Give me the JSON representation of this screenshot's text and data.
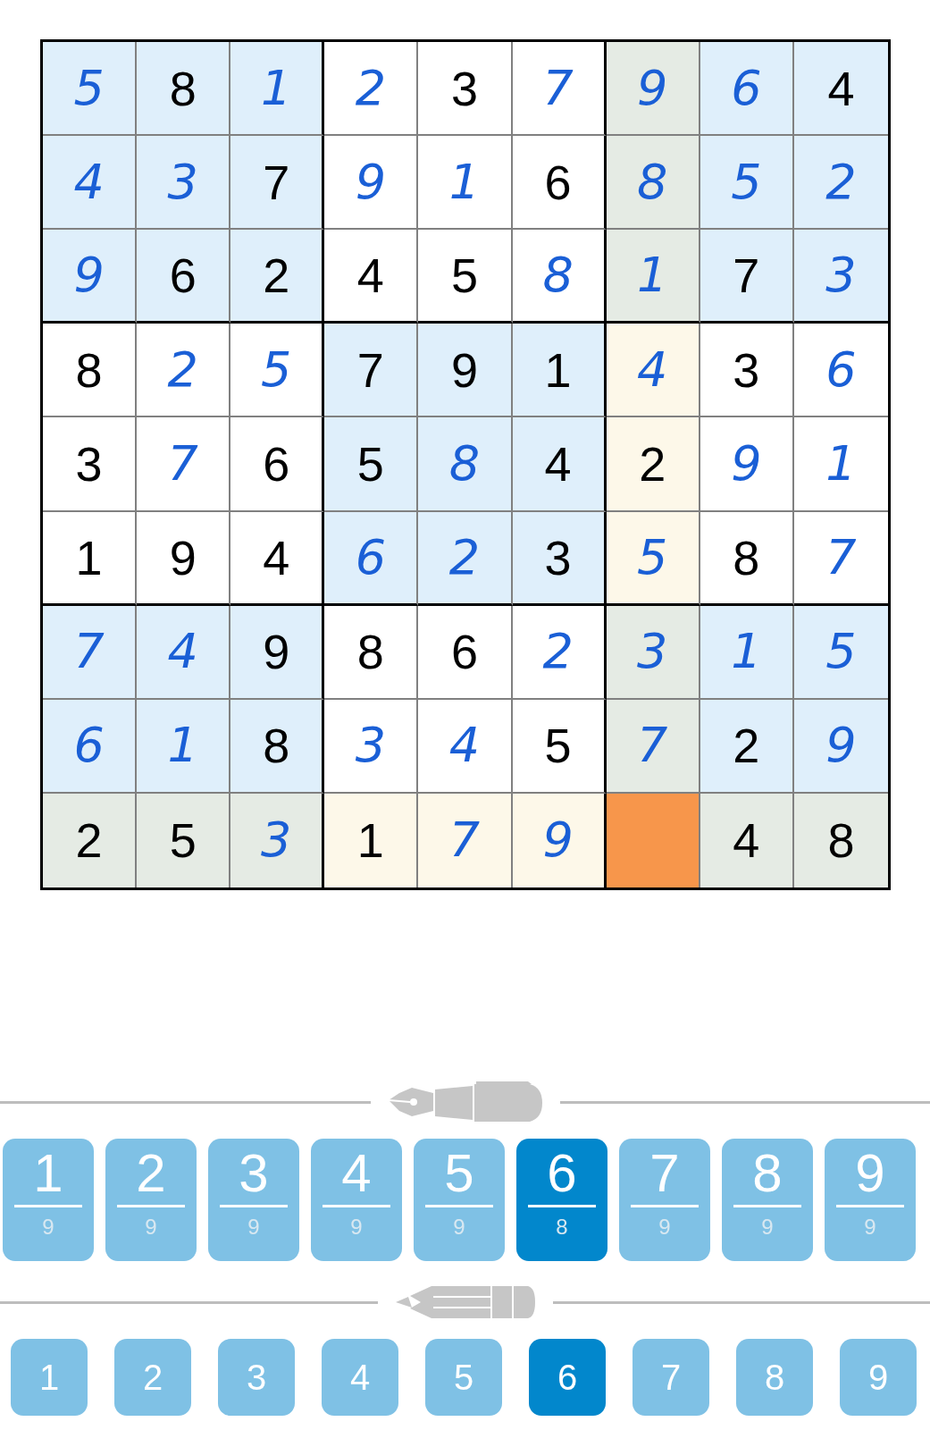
{
  "grid": [
    [
      {
        "value": "5",
        "kind": "entered",
        "color": "#dfeffb",
        "selected": false
      },
      {
        "value": "8",
        "kind": "given",
        "color": "#dfeffb",
        "selected": false
      },
      {
        "value": "1",
        "kind": "entered",
        "color": "#dfeffb",
        "selected": false
      },
      {
        "value": "2",
        "kind": "entered",
        "color": "#ffffff",
        "selected": false
      },
      {
        "value": "3",
        "kind": "given",
        "color": "#ffffff",
        "selected": false
      },
      {
        "value": "7",
        "kind": "entered",
        "color": "#ffffff",
        "selected": false
      },
      {
        "value": "9",
        "kind": "entered",
        "color": "#e5ebe4",
        "selected": false
      },
      {
        "value": "6",
        "kind": "entered",
        "color": "#dfeffb",
        "selected": false
      },
      {
        "value": "4",
        "kind": "given",
        "color": "#dfeffb",
        "selected": false
      }
    ],
    [
      {
        "value": "4",
        "kind": "entered",
        "color": "#dfeffb",
        "selected": false
      },
      {
        "value": "3",
        "kind": "entered",
        "color": "#dfeffb",
        "selected": false
      },
      {
        "value": "7",
        "kind": "given",
        "color": "#dfeffb",
        "selected": false
      },
      {
        "value": "9",
        "kind": "entered",
        "color": "#ffffff",
        "selected": false
      },
      {
        "value": "1",
        "kind": "entered",
        "color": "#ffffff",
        "selected": false
      },
      {
        "value": "6",
        "kind": "given",
        "color": "#ffffff",
        "selected": false
      },
      {
        "value": "8",
        "kind": "entered",
        "color": "#e5ebe4",
        "selected": false
      },
      {
        "value": "5",
        "kind": "entered",
        "color": "#dfeffb",
        "selected": false
      },
      {
        "value": "2",
        "kind": "entered",
        "color": "#dfeffb",
        "selected": false
      }
    ],
    [
      {
        "value": "9",
        "kind": "entered",
        "color": "#dfeffb",
        "selected": false
      },
      {
        "value": "6",
        "kind": "given",
        "color": "#dfeffb",
        "selected": false
      },
      {
        "value": "2",
        "kind": "given",
        "color": "#dfeffb",
        "selected": false
      },
      {
        "value": "4",
        "kind": "given",
        "color": "#ffffff",
        "selected": false
      },
      {
        "value": "5",
        "kind": "given",
        "color": "#ffffff",
        "selected": false
      },
      {
        "value": "8",
        "kind": "entered",
        "color": "#ffffff",
        "selected": false
      },
      {
        "value": "1",
        "kind": "entered",
        "color": "#e5ebe4",
        "selected": false
      },
      {
        "value": "7",
        "kind": "given",
        "color": "#dfeffb",
        "selected": false
      },
      {
        "value": "3",
        "kind": "entered",
        "color": "#dfeffb",
        "selected": false
      }
    ],
    [
      {
        "value": "8",
        "kind": "given",
        "color": "#ffffff",
        "selected": false
      },
      {
        "value": "2",
        "kind": "entered",
        "color": "#ffffff",
        "selected": false
      },
      {
        "value": "5",
        "kind": "entered",
        "color": "#ffffff",
        "selected": false
      },
      {
        "value": "7",
        "kind": "given",
        "color": "#dfeffb",
        "selected": false
      },
      {
        "value": "9",
        "kind": "given",
        "color": "#dfeffb",
        "selected": false
      },
      {
        "value": "1",
        "kind": "given",
        "color": "#dfeffb",
        "selected": false
      },
      {
        "value": "4",
        "kind": "entered",
        "color": "#fdf8e9",
        "selected": false
      },
      {
        "value": "3",
        "kind": "given",
        "color": "#ffffff",
        "selected": false
      },
      {
        "value": "6",
        "kind": "entered",
        "color": "#ffffff",
        "selected": false
      }
    ],
    [
      {
        "value": "3",
        "kind": "given",
        "color": "#ffffff",
        "selected": false
      },
      {
        "value": "7",
        "kind": "entered",
        "color": "#ffffff",
        "selected": false
      },
      {
        "value": "6",
        "kind": "given",
        "color": "#ffffff",
        "selected": false
      },
      {
        "value": "5",
        "kind": "given",
        "color": "#dfeffb",
        "selected": false
      },
      {
        "value": "8",
        "kind": "entered",
        "color": "#dfeffb",
        "selected": false
      },
      {
        "value": "4",
        "kind": "given",
        "color": "#dfeffb",
        "selected": false
      },
      {
        "value": "2",
        "kind": "given",
        "color": "#fdf8e9",
        "selected": false
      },
      {
        "value": "9",
        "kind": "entered",
        "color": "#ffffff",
        "selected": false
      },
      {
        "value": "1",
        "kind": "entered",
        "color": "#ffffff",
        "selected": false
      }
    ],
    [
      {
        "value": "1",
        "kind": "given",
        "color": "#ffffff",
        "selected": false
      },
      {
        "value": "9",
        "kind": "given",
        "color": "#ffffff",
        "selected": false
      },
      {
        "value": "4",
        "kind": "given",
        "color": "#ffffff",
        "selected": false
      },
      {
        "value": "6",
        "kind": "entered",
        "color": "#dfeffb",
        "selected": false
      },
      {
        "value": "2",
        "kind": "entered",
        "color": "#dfeffb",
        "selected": false
      },
      {
        "value": "3",
        "kind": "given",
        "color": "#dfeffb",
        "selected": false
      },
      {
        "value": "5",
        "kind": "entered",
        "color": "#fdf8e9",
        "selected": false
      },
      {
        "value": "8",
        "kind": "given",
        "color": "#ffffff",
        "selected": false
      },
      {
        "value": "7",
        "kind": "entered",
        "color": "#ffffff",
        "selected": false
      }
    ],
    [
      {
        "value": "7",
        "kind": "entered",
        "color": "#dfeffb",
        "selected": false
      },
      {
        "value": "4",
        "kind": "entered",
        "color": "#dfeffb",
        "selected": false
      },
      {
        "value": "9",
        "kind": "given",
        "color": "#dfeffb",
        "selected": false
      },
      {
        "value": "8",
        "kind": "given",
        "color": "#ffffff",
        "selected": false
      },
      {
        "value": "6",
        "kind": "given",
        "color": "#ffffff",
        "selected": false
      },
      {
        "value": "2",
        "kind": "entered",
        "color": "#ffffff",
        "selected": false
      },
      {
        "value": "3",
        "kind": "entered",
        "color": "#e5ebe4",
        "selected": false
      },
      {
        "value": "1",
        "kind": "entered",
        "color": "#dfeffb",
        "selected": false
      },
      {
        "value": "5",
        "kind": "entered",
        "color": "#dfeffb",
        "selected": false
      }
    ],
    [
      {
        "value": "6",
        "kind": "entered",
        "color": "#dfeffb",
        "selected": false
      },
      {
        "value": "1",
        "kind": "entered",
        "color": "#dfeffb",
        "selected": false
      },
      {
        "value": "8",
        "kind": "given",
        "color": "#dfeffb",
        "selected": false
      },
      {
        "value": "3",
        "kind": "entered",
        "color": "#ffffff",
        "selected": false
      },
      {
        "value": "4",
        "kind": "entered",
        "color": "#ffffff",
        "selected": false
      },
      {
        "value": "5",
        "kind": "given",
        "color": "#ffffff",
        "selected": false
      },
      {
        "value": "7",
        "kind": "entered",
        "color": "#e5ebe4",
        "selected": false
      },
      {
        "value": "2",
        "kind": "given",
        "color": "#dfeffb",
        "selected": false
      },
      {
        "value": "9",
        "kind": "entered",
        "color": "#dfeffb",
        "selected": false
      }
    ],
    [
      {
        "value": "2",
        "kind": "given",
        "color": "#e5ebe4",
        "selected": false
      },
      {
        "value": "5",
        "kind": "given",
        "color": "#e5ebe4",
        "selected": false
      },
      {
        "value": "3",
        "kind": "entered",
        "color": "#e5ebe4",
        "selected": false
      },
      {
        "value": "1",
        "kind": "given",
        "color": "#fdf8e9",
        "selected": false
      },
      {
        "value": "7",
        "kind": "entered",
        "color": "#fdf8e9",
        "selected": false
      },
      {
        "value": "9",
        "kind": "entered",
        "color": "#fdf8e9",
        "selected": false
      },
      {
        "kind": "empty",
        "selected": true
      },
      {
        "value": "4",
        "kind": "given",
        "color": "#e5ebe4",
        "selected": false
      },
      {
        "value": "8",
        "kind": "given",
        "color": "#e5ebe4",
        "selected": false
      }
    ]
  ],
  "pen_buttons": [
    {
      "digit": "1",
      "count": "9",
      "selected": false
    },
    {
      "digit": "2",
      "count": "9",
      "selected": false
    },
    {
      "digit": "3",
      "count": "9",
      "selected": false
    },
    {
      "digit": "4",
      "count": "9",
      "selected": false
    },
    {
      "digit": "5",
      "count": "9",
      "selected": false
    },
    {
      "digit": "6",
      "count": "8",
      "selected": true
    },
    {
      "digit": "7",
      "count": "9",
      "selected": false
    },
    {
      "digit": "8",
      "count": "9",
      "selected": false
    },
    {
      "digit": "9",
      "count": "9",
      "selected": false
    }
  ],
  "pencil_buttons": [
    {
      "digit": "1",
      "selected": false
    },
    {
      "digit": "2",
      "selected": false
    },
    {
      "digit": "3",
      "selected": false
    },
    {
      "digit": "4",
      "selected": false
    },
    {
      "digit": "5",
      "selected": false
    },
    {
      "digit": "6",
      "selected": true
    },
    {
      "digit": "7",
      "selected": false
    },
    {
      "digit": "8",
      "selected": false
    },
    {
      "digit": "9",
      "selected": false
    }
  ]
}
